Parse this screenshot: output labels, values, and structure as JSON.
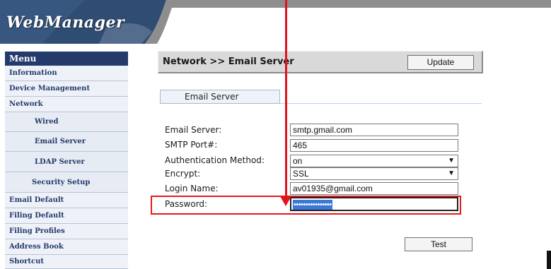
{
  "header": {
    "logo": "WebManager"
  },
  "sidebar": {
    "title": "Menu",
    "items": [
      {
        "label": "Information"
      },
      {
        "label": "Device Management"
      },
      {
        "label": "Network"
      },
      {
        "label": "Wired"
      },
      {
        "label": "Email Server"
      },
      {
        "label": "LDAP Server"
      },
      {
        "label": "Security Setup"
      },
      {
        "label": "Email Default"
      },
      {
        "label": "Filing Default"
      },
      {
        "label": "Filing Profiles"
      },
      {
        "label": "Address Book"
      },
      {
        "label": "Shortcut"
      }
    ]
  },
  "main": {
    "title": "Network >> Email Server",
    "update_label": "Update",
    "tab_label": "Email Server",
    "fields": {
      "email_server": {
        "label": "Email Server:",
        "value": "smtp.gmail.com"
      },
      "smtp_port": {
        "label": "SMTP Port#:",
        "value": "465"
      },
      "auth_method": {
        "label": "Authentication Method:",
        "value": "on"
      },
      "encrypt": {
        "label": "Encrypt:",
        "value": "SSL"
      },
      "login_name": {
        "label": "Login Name:",
        "value": "av01935@gmail.com"
      },
      "password": {
        "label": "Password:",
        "value": "••••••••••••••••"
      }
    },
    "test_label": "Test"
  },
  "annotation": {
    "color": "#e0141a"
  },
  "icons": {
    "dropdown": "chevron-down-icon"
  }
}
